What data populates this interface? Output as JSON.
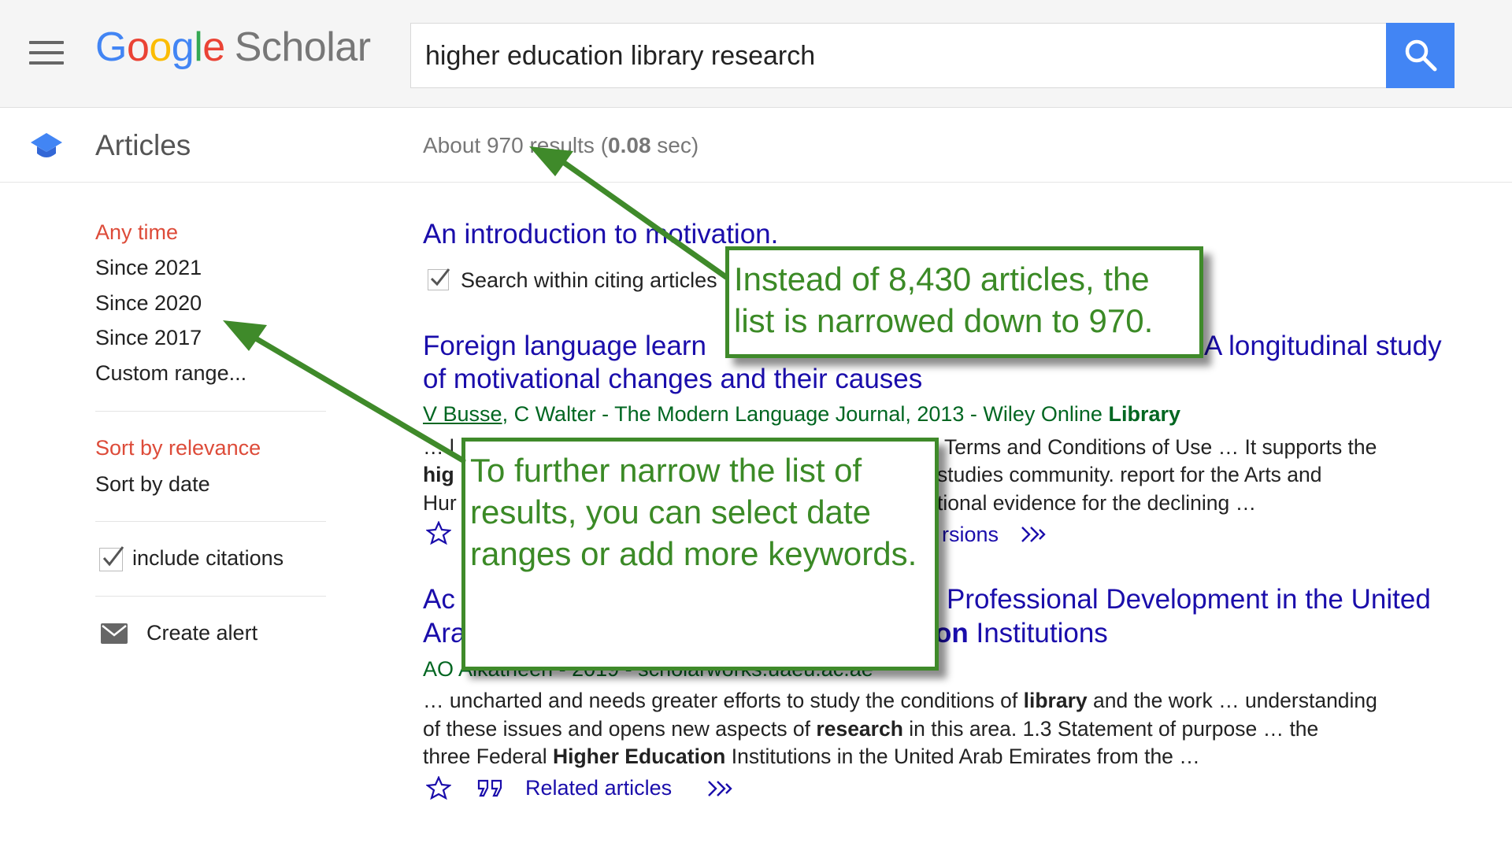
{
  "header": {
    "logo_text": "Google",
    "logo_scholar": "Scholar",
    "search_value": "higher education library research"
  },
  "subbar": {
    "section_label": "Articles",
    "stats_prefix": "About 970 results (",
    "stats_time": "0.08",
    "stats_suffix": " sec)"
  },
  "sidebar": {
    "time_filters": [
      "Any time",
      "Since 2021",
      "Since 2020",
      "Since 2017",
      "Custom range..."
    ],
    "sort_options": [
      "Sort by relevance",
      "Sort by date"
    ],
    "include_citations": "include citations",
    "create_alert": "Create alert"
  },
  "results": [
    {
      "title": "An introduction to motivation.",
      "search_within": "Search within citing articles"
    },
    {
      "title_line1": "Foreign language learning motivation in higher education: A longitudinal study",
      "title_line1_left": "Foreign language learn",
      "title_line1_right": "A longitudinal study",
      "title_line2": "of motivational changes and their causes",
      "meta_author": "V Busse",
      "meta_rest": ", C Walter - The Modern Language Journal, 2013 - Wiley Online ",
      "meta_bold": "Library",
      "snippet1_left": "… l",
      "snippet1_right": "Terms and Conditions of Use … It supports the",
      "snippet2_left": "hig",
      "snippet2_right": "studies community. report for the Arts and",
      "snippet3_left": "Hur",
      "snippet3_right": "tional evidence for the declining …",
      "versions_fragment": "rsions"
    },
    {
      "title_line1_left": "Ac",
      "title_line1_right": "Professional Development in the United",
      "title_line2_left": "Ara",
      "title_line2_right_bold": "on",
      "title_line2_right": " Institutions",
      "meta": "AO Alkatheeri - 2019 - scholarworks.uaeu.ac.ae",
      "snippet1_a": "… uncharted and needs greater efforts to study the conditions of ",
      "snippet1_b": "library",
      "snippet1_c": " and the work … understanding",
      "snippet2_a": "of these issues and opens new aspects of ",
      "snippet2_b": "research",
      "snippet2_c": " in this area. 1.3 Statement of purpose … the",
      "snippet3_a": "three Federal ",
      "snippet3_b": "Higher Education",
      "snippet3_c": " Institutions in the United Arab Emirates from the …",
      "related": "Related articles"
    }
  ],
  "callouts": {
    "top": "Instead of 8,430 articles, the list is narrowed down to 970.",
    "left": "To further narrow the list of results, you can select date ranges or add more keywords."
  },
  "colors": {
    "link": "#1a0dab",
    "meta_green": "#006621",
    "active_red": "#dd4b39",
    "callout_green": "#3f8a2a",
    "search_blue": "#4285f4"
  }
}
